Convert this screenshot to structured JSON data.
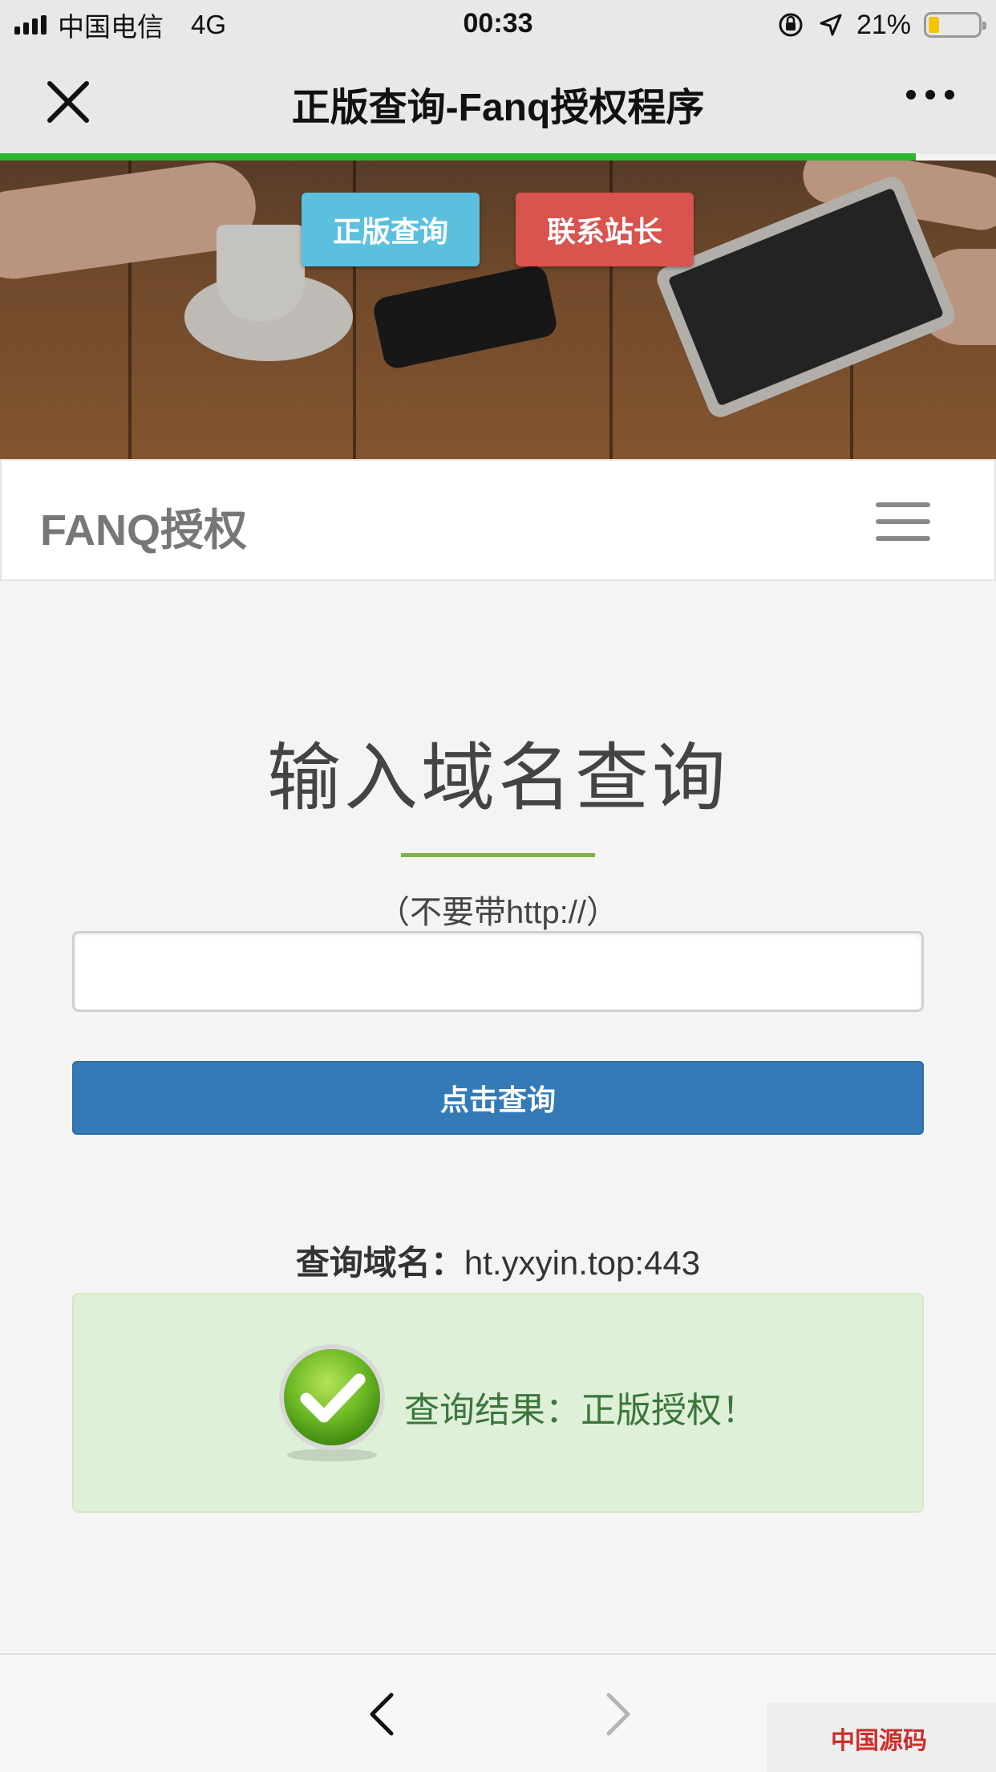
{
  "status_bar": {
    "carrier": "中国电信",
    "network": "4G",
    "time": "00:33",
    "battery": "21%"
  },
  "nav": {
    "title": "正版查询-Fanq授权程序",
    "progress": 0.92
  },
  "hero": {
    "check_button": "正版查询",
    "contact_button": "联系站长"
  },
  "site": {
    "brand": "FANQ授权"
  },
  "query": {
    "heading": "输入域名查询",
    "hint": "（不要带http://）",
    "input_value": "",
    "submit_label": "点击查询"
  },
  "result": {
    "domain_label": "查询域名：",
    "domain_value": "ht.yxyin.top:443",
    "message": "查询结果：正版授权！"
  },
  "watermark": {
    "text": "中国源码"
  },
  "colors": {
    "info": "#5bc0de",
    "danger": "#d9534f",
    "primary": "#337ab7",
    "success_bg": "#dff0d8",
    "success_text": "#3c763d",
    "accent_line": "#7cb342"
  }
}
